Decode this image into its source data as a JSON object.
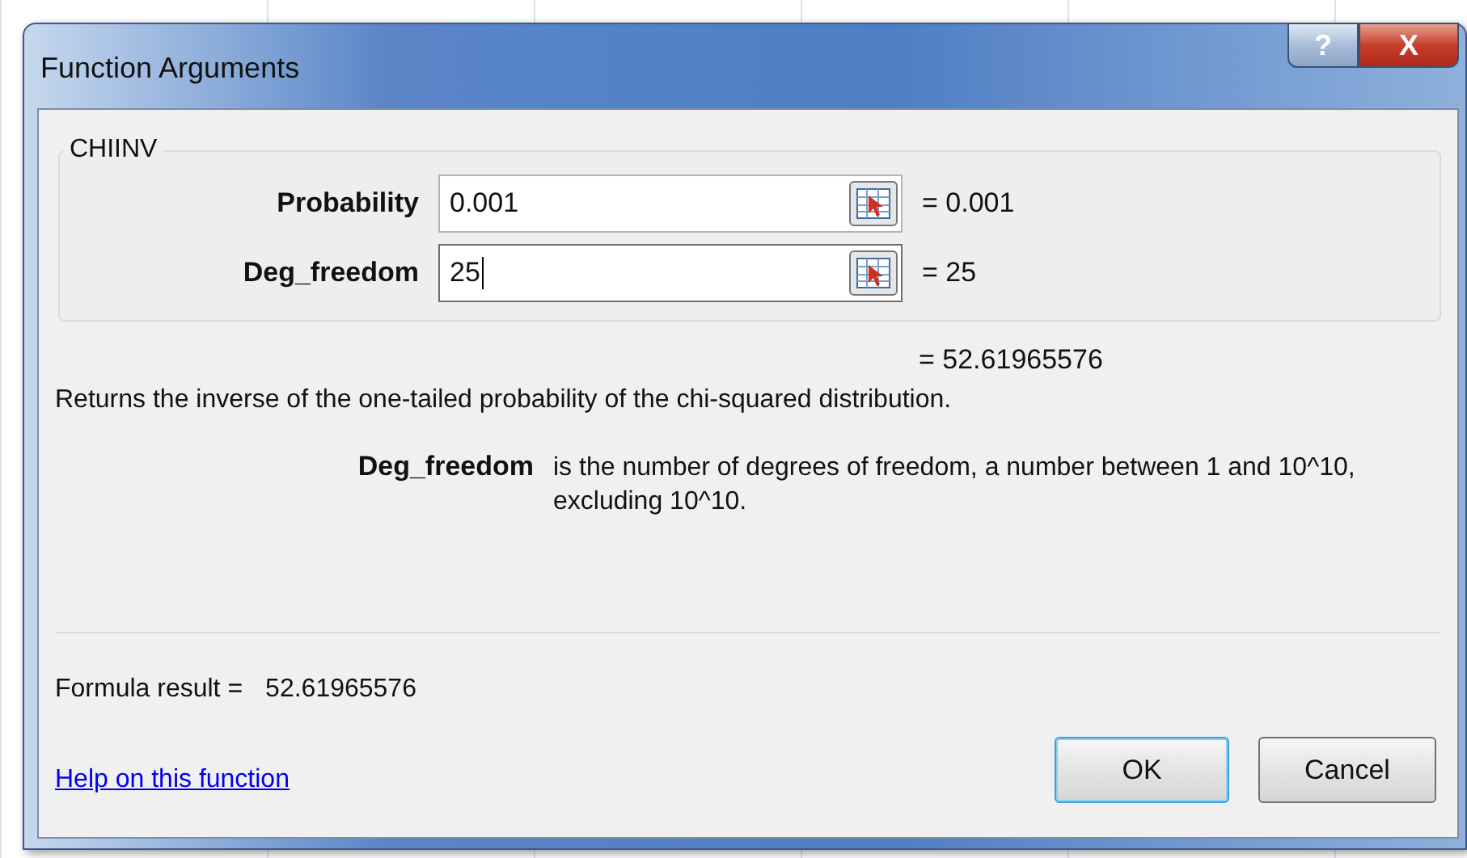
{
  "window": {
    "title": "Function Arguments",
    "controls": [
      {
        "kind": "help",
        "label": "?"
      },
      {
        "kind": "close",
        "label": "X"
      }
    ]
  },
  "function_group": {
    "name": "CHIINV",
    "arguments": [
      {
        "label": "Probability",
        "value": "0.001",
        "focused": false,
        "result": "= 0.001"
      },
      {
        "label": "Deg_freedom",
        "value": "25",
        "focused": true,
        "result": "= 25"
      }
    ]
  },
  "function_result": "= 52.61965576",
  "description": "Returns the inverse of the one-tailed probability of the chi-squared distribution.",
  "argument_help": {
    "name": "Deg_freedom",
    "text": "is the number of degrees of freedom, a number between 1 and 10^10, excluding 10^10."
  },
  "formula_result": {
    "label": "Formula result =",
    "value": "52.61965576"
  },
  "help_link": "Help on this function",
  "buttons": [
    {
      "label": "OK",
      "default": true
    },
    {
      "label": "Cancel",
      "default": false
    }
  ]
}
